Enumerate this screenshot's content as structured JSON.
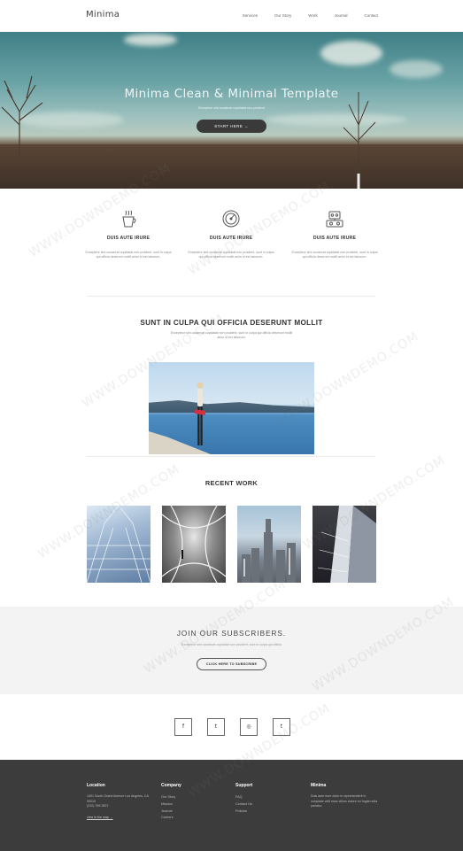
{
  "header": {
    "logo": "Minima",
    "nav": [
      "Services",
      "Our Story",
      "Work",
      "Journal",
      "Contact"
    ]
  },
  "hero": {
    "title": "Minima Clean & Minimal Template",
    "subtitle": "Excepteur sint occaecat cupidatat non proident",
    "button": "START HERE →"
  },
  "features": [
    {
      "icon": "coffee-cup-icon",
      "title": "DUIS AUTE IRURE",
      "text": "Excepteur sint occaecat cupidatat non proident, sunt in culpa qui officia deserunt mollit anim id est laborum."
    },
    {
      "icon": "speedometer-icon",
      "title": "DUIS AUTE IRURE",
      "text": "Excepteur sint occaecat cupidatat non proident, sunt in culpa qui officia deserunt mollit anim id est laborum."
    },
    {
      "icon": "robot-icon",
      "title": "DUIS AUTE IRURE",
      "text": "Excepteur sint occaecat cupidatat non proident, sunt in culpa qui officia deserunt mollit anim id est laborum."
    }
  ],
  "section": {
    "title": "SUNT IN CULPA QUI OFFICIA DESERUNT MOLLIT",
    "text": "Excepteur sint occaecat cupidatat non proident, sunt in culpa qui officia deserunt mollit anim id est laborum."
  },
  "recent": {
    "title": "RECENT WORK"
  },
  "subscribe": {
    "title": "JOIN OUR SUBSCRIBERS.",
    "text": "Excepteur sint occaecat cupidatat non proident, sunt in culpa qui officia",
    "button": "CLICK HERE TO SUBSCRIBE"
  },
  "social": [
    {
      "icon": "facebook-icon",
      "glyph": "f"
    },
    {
      "icon": "twitter-icon",
      "glyph": "t"
    },
    {
      "icon": "instagram-icon",
      "glyph": "◎"
    },
    {
      "icon": "tumblr-icon",
      "glyph": "t"
    }
  ],
  "footer": {
    "location": {
      "heading": "Location",
      "address": "1401 South Grand Avenue Los Angeles, CA 90015",
      "phone": "(310) 789-9871",
      "link": "view in the map →"
    },
    "company": {
      "heading": "Company",
      "links": [
        "Our Story",
        "Mission",
        "Journal",
        "Careers"
      ]
    },
    "support": {
      "heading": "Support",
      "links": [
        "FAQ",
        "Contact Us",
        "Policies"
      ]
    },
    "minima": {
      "heading": "Minima",
      "text": "Duis aute irure dolor in reprehenderit in voluptate velit esse cillum dolore eu fugiat nulla pariatur."
    }
  },
  "watermark": "WWW.DOWNDEMO.COM",
  "colors": {
    "footer_bg": "#3c3c3c",
    "hero_button": "#3a3a3a",
    "subscribe_bg": "#f3f3f3"
  }
}
